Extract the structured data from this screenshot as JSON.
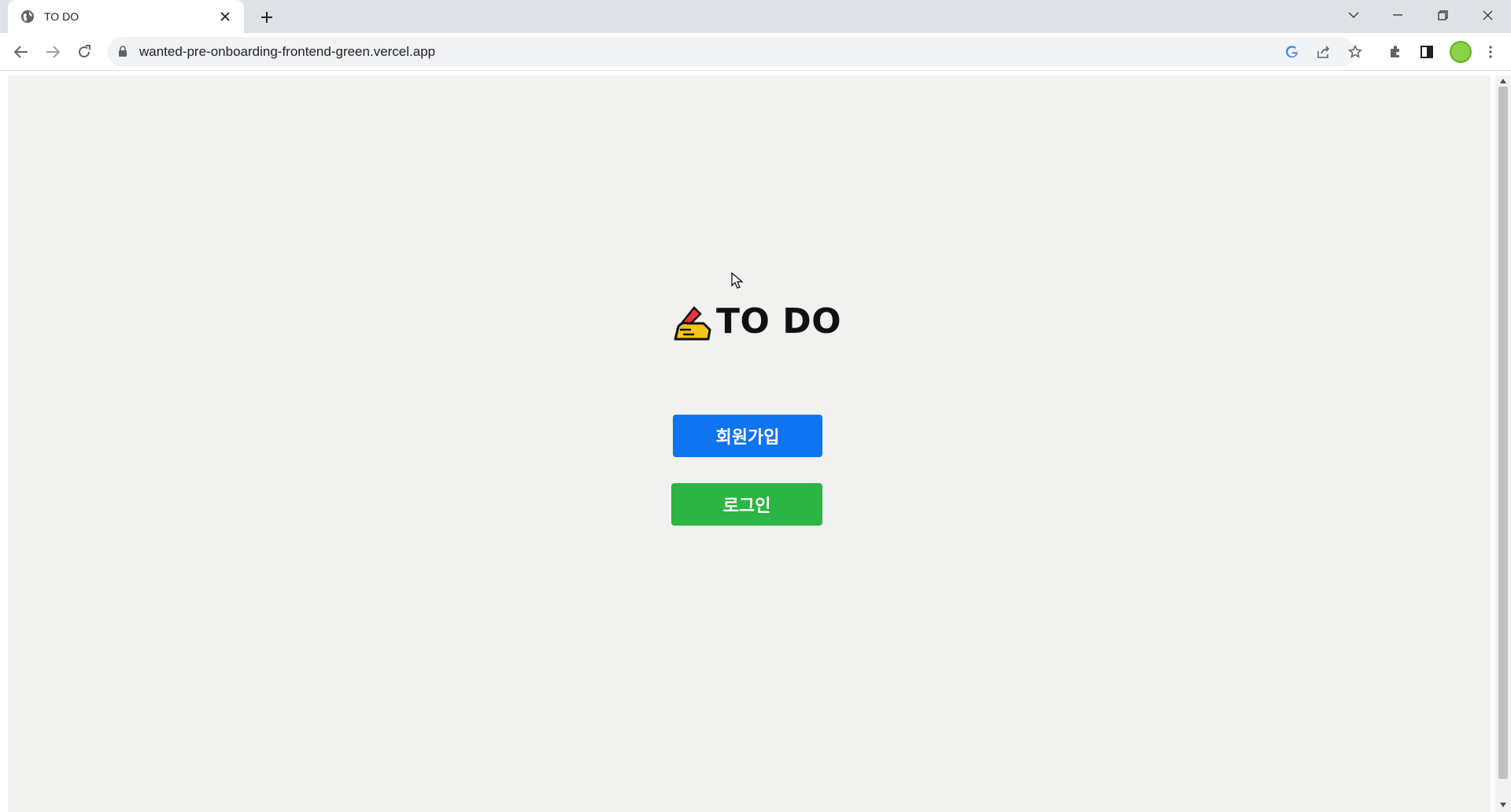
{
  "browser": {
    "tab": {
      "title": "TO DO",
      "favicon_icon": "globe-icon"
    },
    "address": {
      "url": "wanted-pre-onboarding-frontend-green.vercel.app"
    },
    "colors": {
      "tabstrip": "#dee1e6",
      "page_background": "#f1f1ef"
    }
  },
  "page": {
    "logo_emoji_icon": "writing-hand-icon",
    "title": "TO DO",
    "buttons": {
      "signup_label": "회원가입",
      "login_label": "로그인"
    },
    "colors": {
      "signup": "#0f74ef",
      "login": "#2bb544"
    }
  }
}
